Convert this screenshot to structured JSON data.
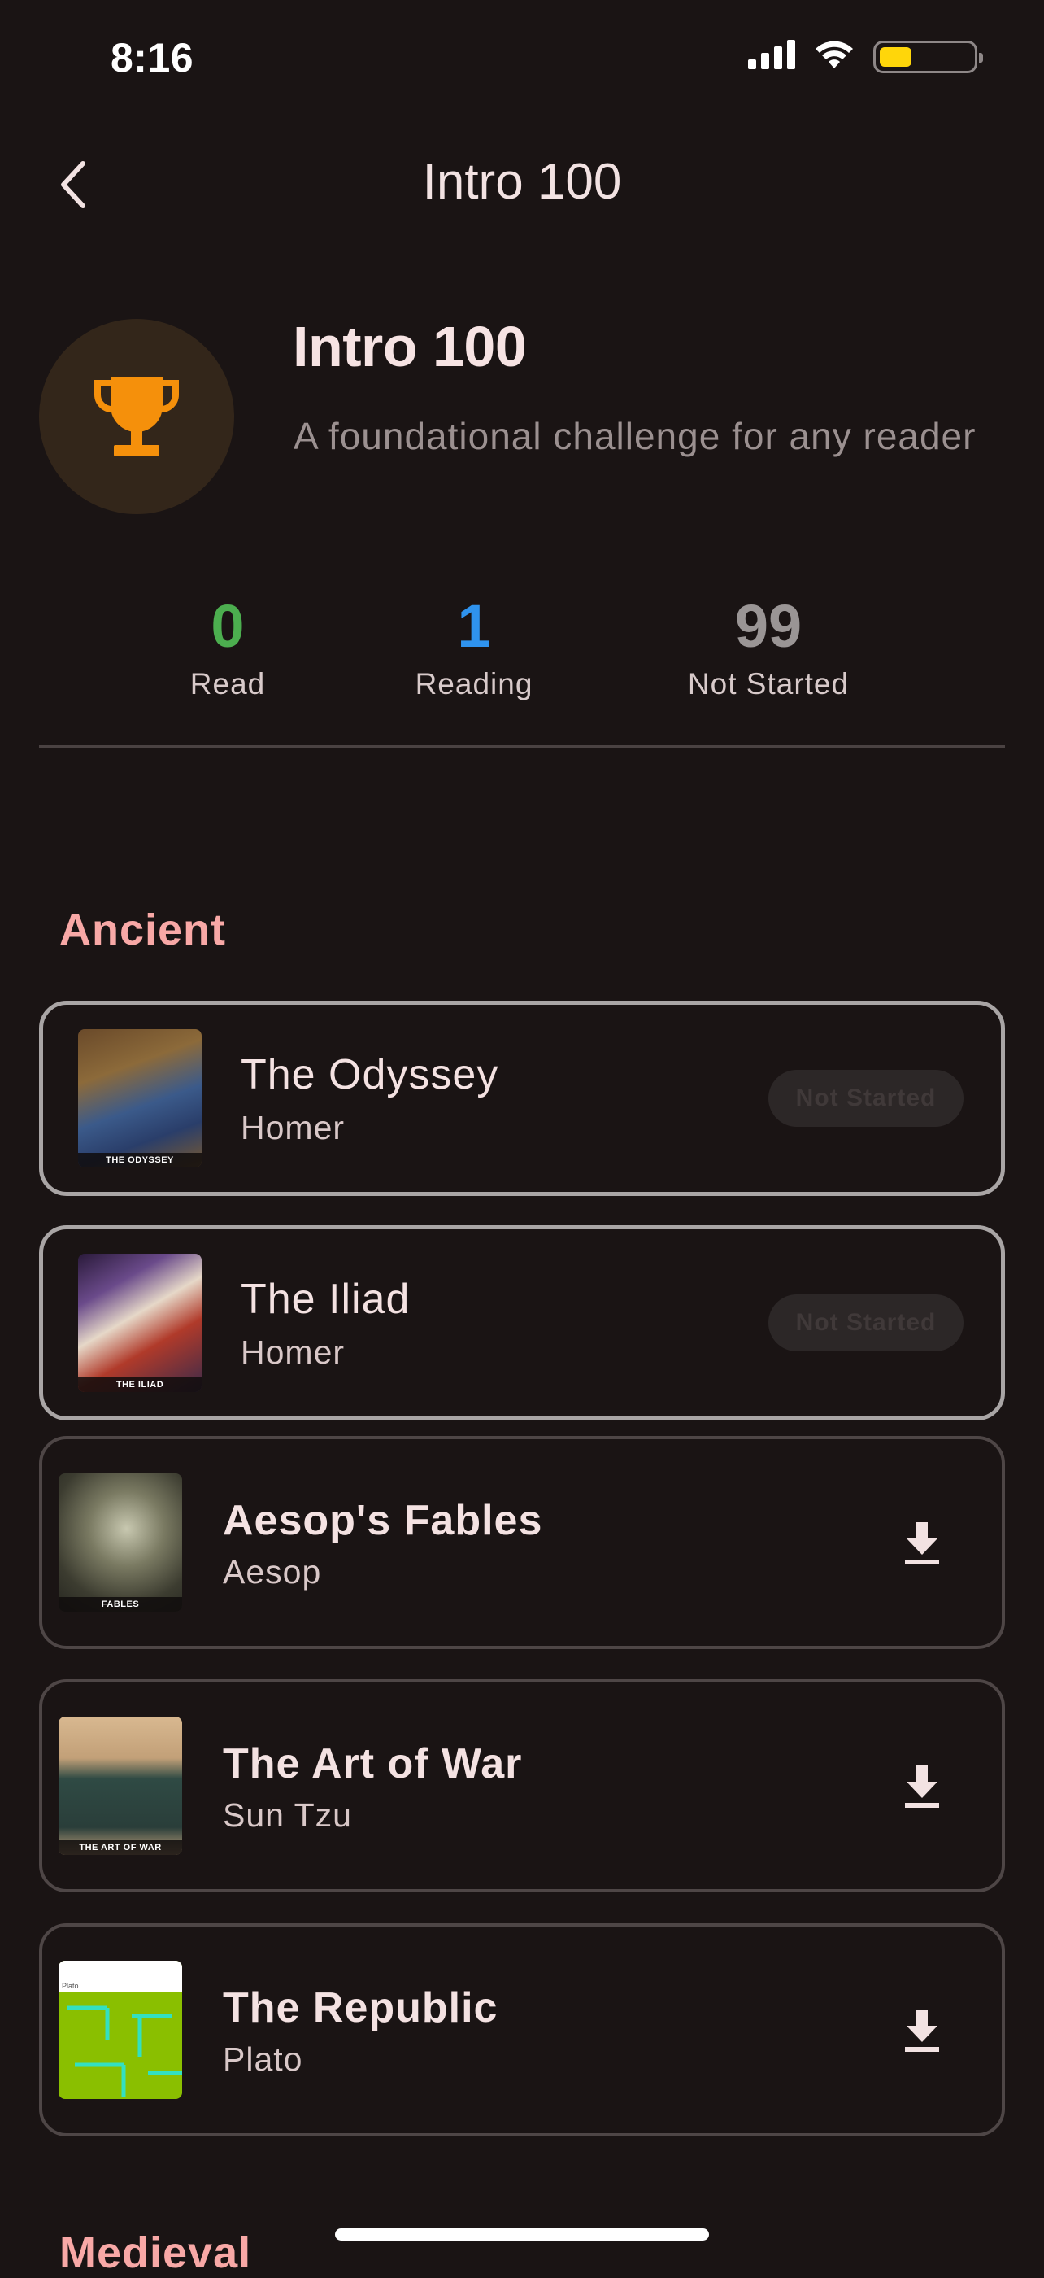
{
  "status_bar": {
    "time": "8:16",
    "battery_color": "#ffd60a",
    "battery_level": 0.35,
    "icons": [
      "signal-icon",
      "wifi-icon",
      "battery-icon"
    ]
  },
  "nav": {
    "title": "Intro 100",
    "back_icon": "chevron-left-icon"
  },
  "header": {
    "title": "Intro 100",
    "description": "A foundational challenge for any reader",
    "icon": "trophy-icon",
    "icon_color": "#f5900b"
  },
  "stats": [
    {
      "value": "0",
      "label": "Read",
      "color": "#4cae4f"
    },
    {
      "value": "1",
      "label": "Reading",
      "color": "#2f93ee"
    },
    {
      "value": "99",
      "label": "Not Started",
      "color": "#9a9595"
    }
  ],
  "sections": [
    {
      "title": "Ancient",
      "books": [
        {
          "title": "The Odyssey",
          "author": "Homer",
          "status": "Not Started",
          "action": "status",
          "cover_caption": "THE ODYSSEY"
        },
        {
          "title": "The Iliad",
          "author": "Homer",
          "status": "Not Started",
          "action": "status",
          "cover_caption": "THE ILIAD"
        },
        {
          "title": "Aesop's Fables",
          "author": "Aesop",
          "action": "download",
          "cover_caption": "FABLES"
        },
        {
          "title": "The Art of War",
          "author": "Sun Tzu",
          "action": "download",
          "cover_caption": "THE ART OF WAR"
        },
        {
          "title": "The Republic",
          "author": "Plato",
          "action": "download",
          "cover_caption": "Plato"
        }
      ]
    },
    {
      "title": "Medieval"
    }
  ],
  "colors": {
    "background": "#1a1414",
    "accent": "#f8a8a6",
    "card_border_started": "#a9a5a5",
    "card_border": "#4e4646"
  }
}
